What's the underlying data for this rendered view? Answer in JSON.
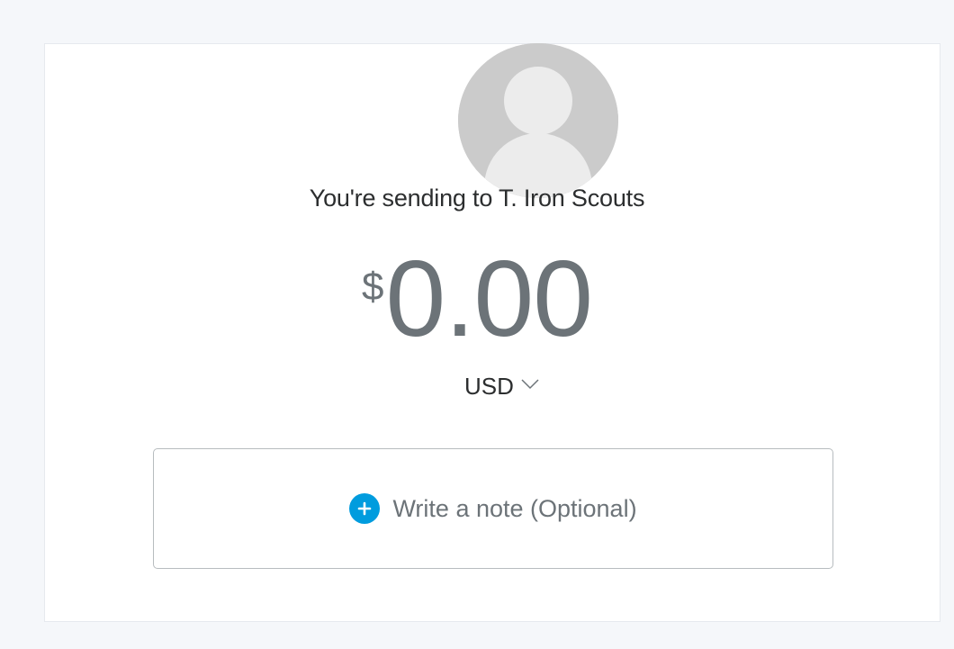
{
  "recipient": {
    "sending_text": "You're sending to T. Iron Scouts",
    "avatar_icon": "default-user-avatar-icon"
  },
  "amount": {
    "currency_symbol": "$",
    "value": "0.00"
  },
  "currency": {
    "selected": "USD",
    "icon": "chevron-down-icon"
  },
  "note": {
    "label": "Write a note (Optional)",
    "icon": "plus-circle-icon"
  },
  "colors": {
    "accent": "#009cde",
    "amount_text": "#6c7378",
    "primary_text": "#2c2e2f",
    "avatar_bg": "#cbcbcb",
    "page_bg": "#f5f7fa"
  }
}
